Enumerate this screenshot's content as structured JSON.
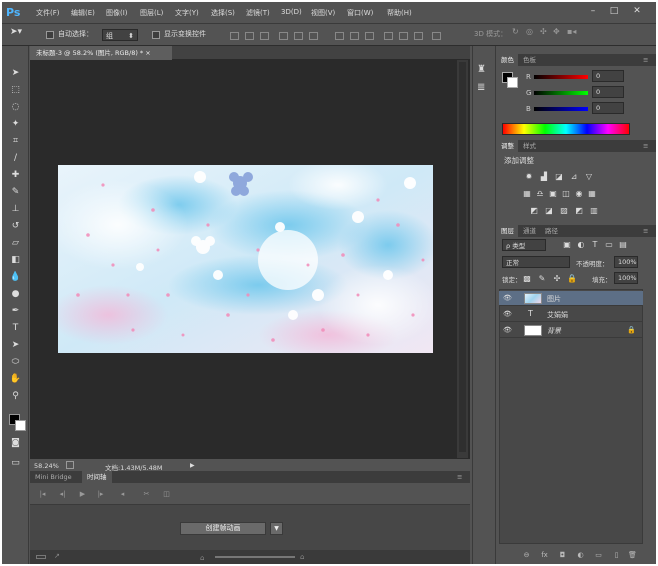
{
  "app": {
    "logo": "Ps"
  },
  "menu": [
    "文件(F)",
    "编辑(E)",
    "图像(I)",
    "图层(L)",
    "文字(Y)",
    "选择(S)",
    "滤镜(T)",
    "3D(D)",
    "视图(V)",
    "窗口(W)",
    "帮助(H)"
  ],
  "window_buttons": [
    "–",
    "□",
    "✕"
  ],
  "options": {
    "auto_select_label": "自动选择：",
    "auto_select_value": "组",
    "show_transform_label": "显示变换控件",
    "mode_3d_label": "3D 模式："
  },
  "document": {
    "tab_title": "未标题-3 @ 58.2% (图片, RGB/8) *",
    "tab_close": "×"
  },
  "status": {
    "zoom": "58.24%",
    "doc_info": "文档:1.43M/5.48M"
  },
  "timeline": {
    "tabs": [
      "Mini Bridge",
      "时间轴"
    ],
    "create_button": "创建帧动画",
    "dropdown_arrow": "▼"
  },
  "color_panel": {
    "tabs": [
      "颜色",
      "色板"
    ],
    "channels": [
      {
        "label": "R",
        "value": "0"
      },
      {
        "label": "G",
        "value": "0"
      },
      {
        "label": "B",
        "value": "0"
      }
    ]
  },
  "adjust_panel": {
    "tabs": [
      "调整",
      "样式"
    ],
    "title": "添加调整",
    "icons_row1": [
      "✹",
      "▟",
      "◪",
      "⊿",
      "▽"
    ],
    "icons_row2": [
      "▦",
      "♎",
      "▣",
      "◫",
      "◉",
      "▦"
    ],
    "icons_row3": [
      "◩",
      "◪",
      "▨",
      "◩",
      "▥"
    ]
  },
  "layers_panel": {
    "tabs": [
      "图层",
      "通道",
      "路径"
    ],
    "filter_label": "ρ 类型",
    "blend_mode": "正常",
    "opacity_label": "不透明度：",
    "opacity_value": "100%",
    "lock_label": "锁定：",
    "fill_label": "填充：",
    "fill_value": "100%",
    "layers": [
      {
        "name": "图片",
        "type": "image",
        "selected": true
      },
      {
        "name": "艾娟娟",
        "type": "text",
        "selected": false
      },
      {
        "name": "背景",
        "type": "background",
        "selected": false,
        "locked": true
      }
    ],
    "bottom_icons": [
      "⊖",
      "fx",
      "◘",
      "◐",
      "▭",
      "▯",
      "🗑"
    ]
  },
  "colors": {
    "accent_blue": "#4fb6ff",
    "layer_selected": "#5d6f86"
  }
}
